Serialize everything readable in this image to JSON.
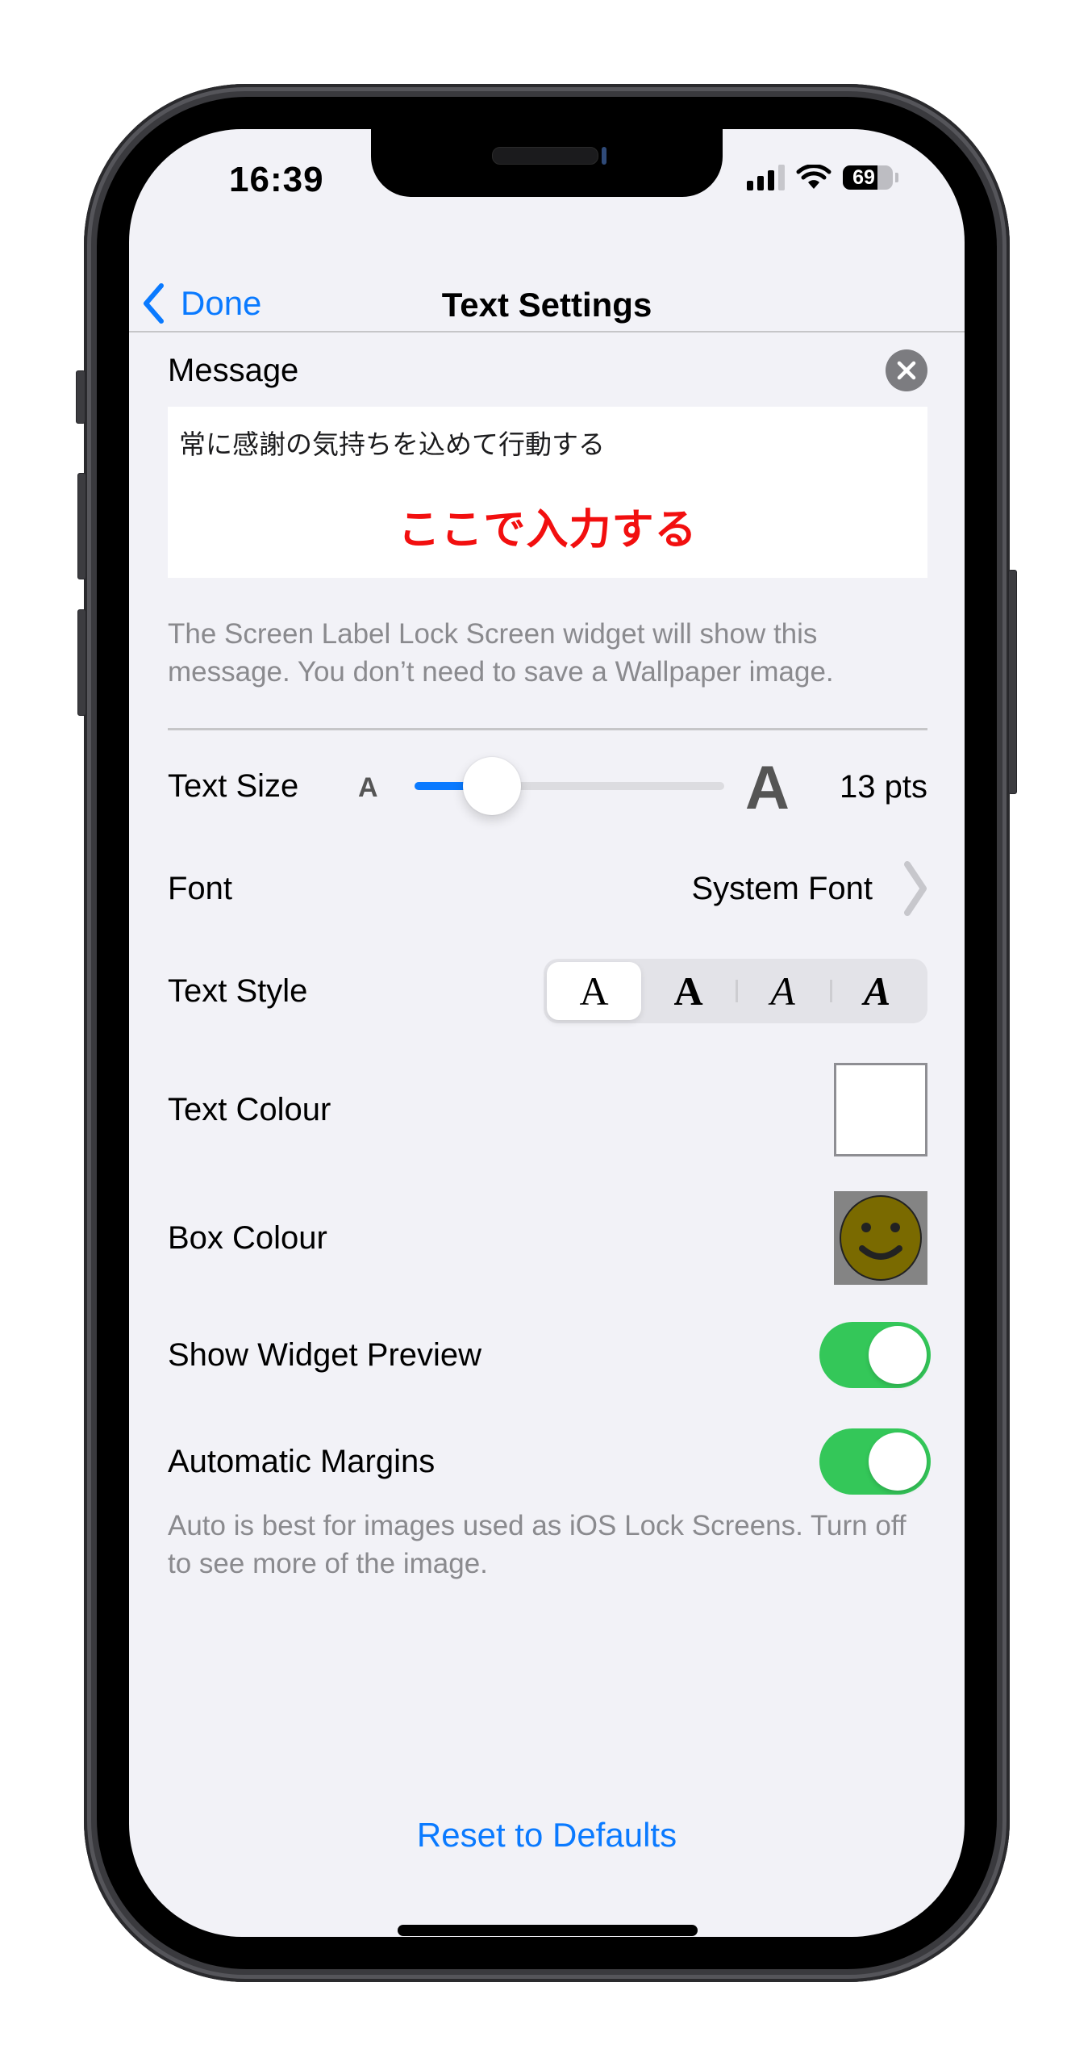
{
  "status_bar": {
    "time": "16:39",
    "battery_percent": "69",
    "battery_level": 0.69,
    "icons": [
      "cellular-signal-icon",
      "wifi-icon",
      "battery-icon"
    ]
  },
  "nav": {
    "back_label": "Done",
    "title": "Text Settings"
  },
  "message": {
    "label": "Message",
    "value": "常に感謝の気持ちを込めて行動する",
    "overlay_annotation": "ここで入力する",
    "footnote": "The Screen Label Lock Screen widget will show this message. You don’t need to save a Wallpaper image."
  },
  "text_size": {
    "label": "Text Size",
    "small_glyph": "A",
    "large_glyph": "A",
    "value_label": "13 pts",
    "slider_fraction": 0.25
  },
  "font": {
    "label": "Font",
    "value": "System Font"
  },
  "text_style": {
    "label": "Text Style",
    "options": [
      {
        "name": "regular",
        "glyph": "A",
        "selected": true
      },
      {
        "name": "bold",
        "glyph": "A",
        "selected": false
      },
      {
        "name": "italic",
        "glyph": "A",
        "selected": false
      },
      {
        "name": "bold-italic",
        "glyph": "A",
        "selected": false
      }
    ]
  },
  "text_colour": {
    "label": "Text Colour",
    "color": "#ffffff"
  },
  "box_colour": {
    "label": "Box Colour",
    "color": "#848484",
    "icon": "smiley-face-icon",
    "face_color": "#7a6a00"
  },
  "show_widget_preview": {
    "label": "Show Widget Preview",
    "on": true
  },
  "automatic_margins": {
    "label": "Automatic Margins",
    "on": true,
    "footnote": "Auto is best for images used as iOS Lock Screens. Turn off to see more of the image."
  },
  "reset_label": "Reset to Defaults",
  "colors": {
    "accent": "#0a7aff",
    "toggle_on": "#34c759",
    "annotation_red": "#f20f0f",
    "background": "#f2f2f7"
  }
}
